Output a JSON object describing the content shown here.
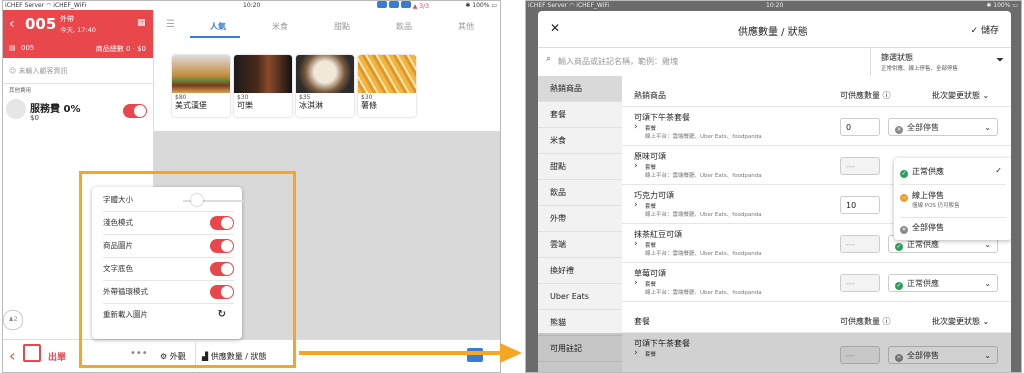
{
  "left_status": {
    "carrier": "iCHEF Server",
    "wifi": "iCHEF_WiFi",
    "time": "10:20",
    "battery": "100%"
  },
  "order_header": {
    "order_no": "005",
    "type": "外帶",
    "date_time": "今天, 17:40"
  },
  "order_bar": {
    "order_no": "005",
    "total_label": "商品總數 0 · $0"
  },
  "customer_placeholder": "未輸入顧客資訊",
  "other_fees_label": "其他費用",
  "service_fee": {
    "name": "服務費",
    "rate": "0%",
    "amount": "$0"
  },
  "guest_count": "2",
  "table_indicator": "3/3",
  "menu_tabs": [
    "人氣",
    "米食",
    "甜點",
    "飲品",
    "其他"
  ],
  "products": [
    {
      "price": "$80",
      "name": "美式漢堡"
    },
    {
      "price": "$30",
      "name": "可樂"
    },
    {
      "price": "$35",
      "name": "冰淇淋"
    },
    {
      "price": "$30",
      "name": "薯條"
    }
  ],
  "popup": {
    "font_size_label": "字體大小",
    "rows": [
      "淺色模式",
      "商品圖片",
      "文字底色",
      "外帶循環模式"
    ],
    "reload_label": "重新載入圖片"
  },
  "bottom": {
    "checkout": "出單",
    "appearance": "外觀",
    "supply": "供應數量 / 狀態"
  },
  "right_status": {
    "carrier": "iCHEF Server",
    "wifi": "iCHEF_WiFi",
    "time": "10:20",
    "battery": "100%"
  },
  "modal": {
    "title": "供應數量 / 狀態",
    "save": "儲存",
    "search_placeholder": "輸入商品或註記名稱，範例：雞塊",
    "filter_title": "篩選狀態",
    "filter_sub": "正常供應、線上停售、全部停售"
  },
  "categories": [
    "熱銷商品",
    "套餐",
    "米食",
    "甜點",
    "飲品",
    "外帶",
    "雲端",
    "換好禮",
    "Uber Eats",
    "熊貓",
    "可用註記"
  ],
  "section1": {
    "title": "熱銷商品",
    "qty_header": "可供應數量",
    "batch": "批次變更狀態"
  },
  "section2": {
    "title": "套餐",
    "qty_header": "可供應數量",
    "batch": "批次變更狀態"
  },
  "items": [
    {
      "name": "可頌下午茶套餐",
      "sub1": "套餐",
      "sub2": "線上平台：雲端餐廳、Uber Eats、foodpanda",
      "qty": "0",
      "status": "全部停售"
    },
    {
      "name": "原味可頌",
      "sub1": "套餐",
      "sub2": "線上平台：雲端餐廳、Uber Eats、foodpanda",
      "qty": "---",
      "status": ""
    },
    {
      "name": "巧克力可頌",
      "sub1": "套餐",
      "sub2": "線上平台：雲端餐廳、Uber Eats、foodpanda",
      "qty": "10",
      "status": ""
    },
    {
      "name": "抹茶紅豆可頌",
      "sub1": "套餐",
      "sub2": "線上平台：雲端餐廳、Uber Eats、foodpanda",
      "qty": "---",
      "status": "正常供應"
    },
    {
      "name": "草莓可頌",
      "sub1": "套餐",
      "sub2": "線上平台：雲端餐廳、Uber Eats、foodpanda",
      "qty": "---",
      "status": "正常供應"
    },
    {
      "name": "可頌下午茶套餐",
      "sub1": "套餐",
      "sub2": "",
      "qty": "---",
      "status": "全部停售"
    }
  ],
  "dropdown": {
    "normal": "正常供應",
    "online_stop": "線上停售",
    "online_stop_sub": "僅線 POS 仍可販售",
    "all_stop": "全部停售"
  },
  "colors": {
    "red": "#e8474b",
    "orange": "#f5a623",
    "green": "#2e9e5b",
    "grey": "#8a8a8a",
    "orange_dot": "#e8a23a",
    "tab_blue": "#3a7bd5"
  }
}
